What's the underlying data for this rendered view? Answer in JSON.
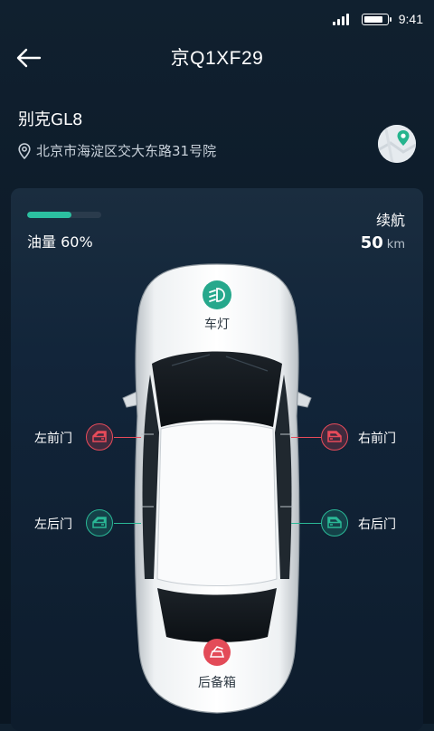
{
  "status": {
    "time": "9:41",
    "battery_level": 0.85
  },
  "header": {
    "title": "京Q1XF29"
  },
  "vehicle": {
    "name": "别克GL8",
    "address": "北京市海淀区交大东路31号院"
  },
  "fuel": {
    "label": "油量 60%",
    "level": 0.6
  },
  "range": {
    "label": "续航",
    "value": "50",
    "unit": "km"
  },
  "controls": {
    "lights": "车灯",
    "front_left": "左前门",
    "front_right": "右前门",
    "rear_left": "左后门",
    "rear_right": "右后门",
    "trunk": "后备箱"
  },
  "colors": {
    "accent": "#2bc0a0",
    "alert": "#e84b5a",
    "ok": "#2ab896",
    "background": "#10202f"
  },
  "icons": [
    "signal-icon",
    "battery-icon",
    "back-arrow-icon",
    "location-pin-icon",
    "map-icon",
    "headlight-icon",
    "car-door-icon",
    "trunk-icon"
  ]
}
